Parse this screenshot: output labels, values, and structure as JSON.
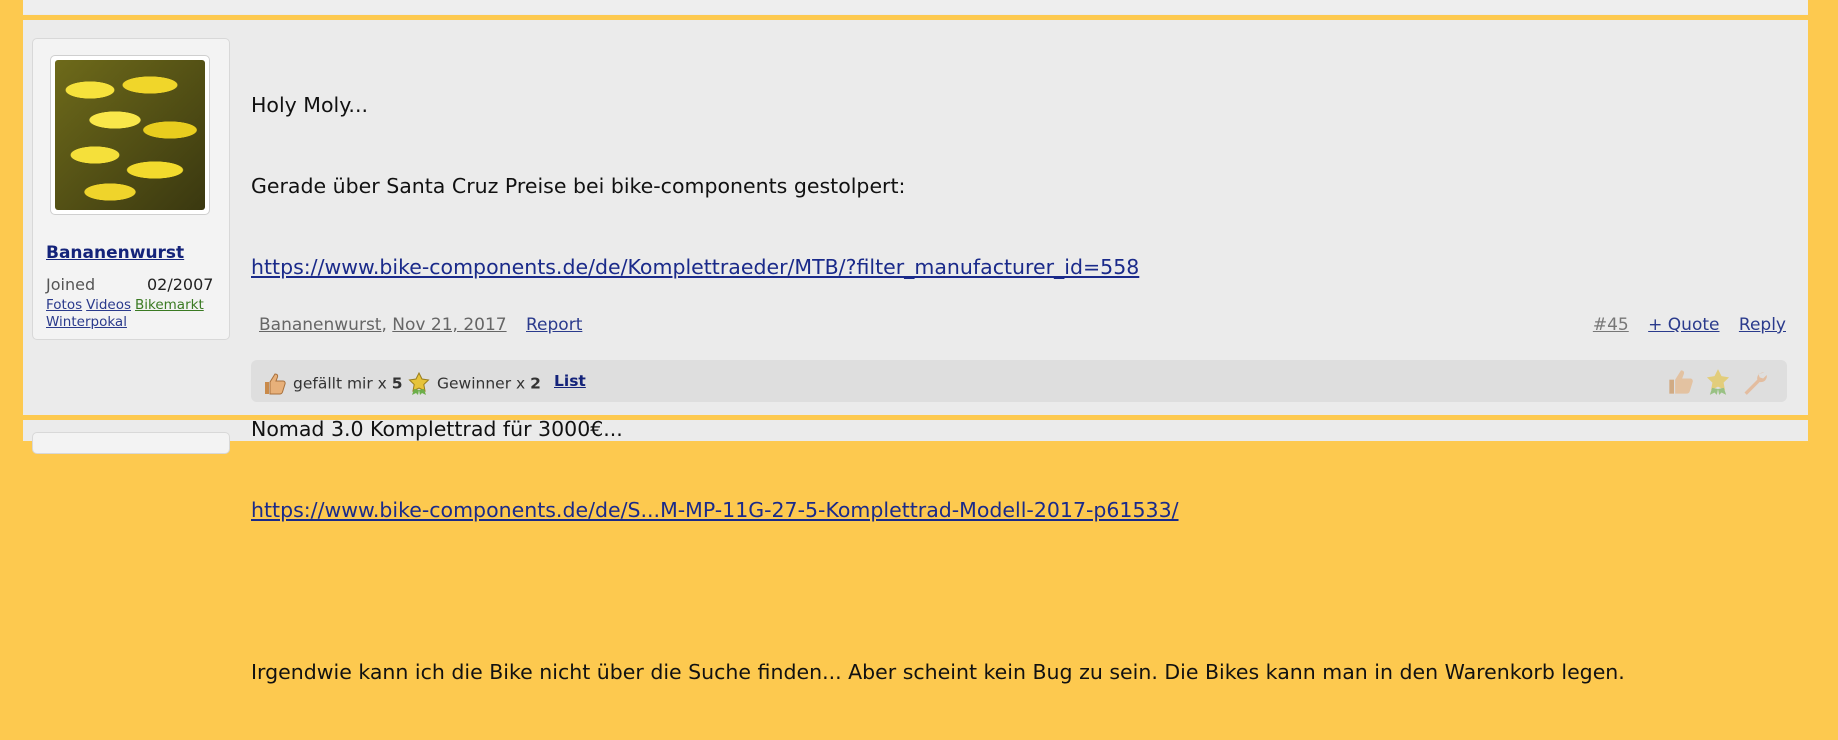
{
  "user": {
    "name": "Bananenwurst",
    "joined_label": "Joined",
    "joined_value": "02/2007",
    "links": [
      "Fotos",
      "Videos",
      "Bikemarkt",
      "Winterpokal"
    ]
  },
  "message": {
    "line1": "Holy Moly...",
    "line2": "Gerade über Santa Cruz Preise bei bike-components gestolpert:",
    "link1": "https://www.bike-components.de/de/Komplettraeder/MTB/?filter_manufacturer_id=558",
    "line4": "Nomad 3.0 Komplettrad für 3000€...",
    "link2": "https://www.bike-components.de/de/S...M-MP-11G-27-5-Komplettrad-Modell-2017-p61533/",
    "line7": "Irgendwie kann ich die Bike nicht über die Suche finden... Aber scheint kein Bug zu sein. Die Bikes kann man in den Warenkorb legen."
  },
  "meta": {
    "author": "Bananenwurst",
    "sep": ",",
    "date": "Nov 21, 2017",
    "report": "Report"
  },
  "actions": {
    "number": "#45",
    "quote": "+ Quote",
    "reply": "Reply"
  },
  "likes": {
    "like_label": "gefällt mir x",
    "like_count": "5",
    "winner_label": "Gewinner x",
    "winner_count": "2",
    "list": "List"
  },
  "icons": [
    "thumbs-up-icon",
    "medal-icon",
    "thumbs-up-icon",
    "medal-icon",
    "wrench-icon"
  ]
}
